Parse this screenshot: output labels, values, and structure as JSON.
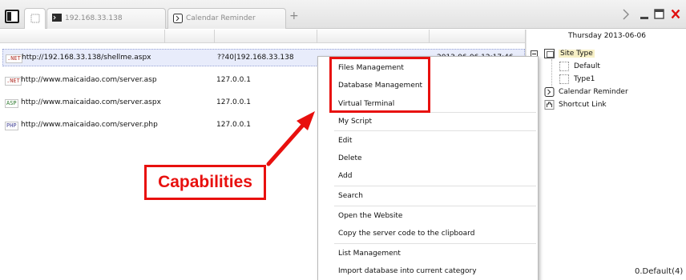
{
  "tabs": [
    {
      "label": ""
    },
    {
      "label": "192.168.33.138",
      "icon": "terminal-icon"
    },
    {
      "label": "Calendar Reminder",
      "icon": "calendar-reminder-icon"
    }
  ],
  "window_controls": {
    "icons": [
      "chevron-right-icon",
      "minimize-icon",
      "maximize-icon",
      "close-icon"
    ],
    "close_color": "#e01010"
  },
  "sites": [
    {
      "type": ".NET",
      "url": "http://192.168.33.138/shellme.aspx",
      "ip": "??40|192.168.33.138",
      "date": "2013-06-06 12:17:46",
      "selected": true
    },
    {
      "type": ".NET",
      "url": "http://www.maicaidao.com/server.asp",
      "ip": "127.0.0.1",
      "date": ""
    },
    {
      "type": "ASP",
      "url": "http://www.maicaidao.com/server.aspx",
      "ip": "127.0.0.1",
      "date": ""
    },
    {
      "type": "PHP",
      "url": "http://www.maicaidao.com/server.php",
      "ip": "127.0.0.1",
      "date": ""
    }
  ],
  "tree": {
    "date": "Thursday 2013-06-06",
    "root": "Site Type",
    "children": [
      "Default",
      "Type1"
    ],
    "calendar_reminder": "Calendar Reminder",
    "shortcut_link": "Shortcut Link"
  },
  "context_menu": {
    "items": [
      "Files Management",
      "Database Management",
      "Virtual Terminal",
      "My Script",
      "Edit",
      "Delete",
      "Add",
      "Search",
      "Open the Website",
      "Copy the server code to the clipboard",
      "List Management",
      "Import database into current category"
    ]
  },
  "annotation": {
    "label": "Capabilities",
    "color": "#e8100e"
  },
  "status": {
    "text": "0.Default(4)"
  },
  "colors": {
    "selection": "#e8ecfb",
    "tree_selected": "#f7f0c6"
  }
}
